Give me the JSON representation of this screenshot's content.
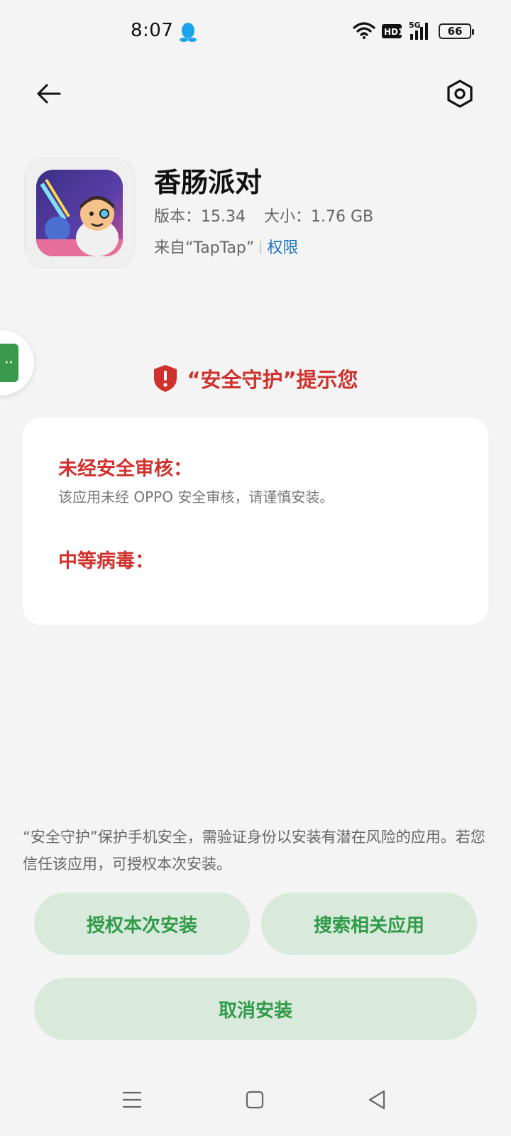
{
  "status_bar": {
    "time": "8:07",
    "hd_label": "HD1",
    "network_label": "5G",
    "battery": "66"
  },
  "app": {
    "name": "香肠派对",
    "version_label": "版本：15.34",
    "size_label": "大小：1.76 GB",
    "source_label": "来自“TapTap”",
    "permission_link": "权限"
  },
  "floating_tab": {
    "label": "··"
  },
  "security": {
    "title": "“安全守护”提示您",
    "unreviewed_heading": "未经安全审核：",
    "unreviewed_text": "该应用未经 OPPO 安全审核，请谨慎安装。",
    "virus_heading": "中等病毒："
  },
  "footer_note": "“安全守护”保护手机安全，需验证身份以安装有潜在风险的应用。若您信任该应用，可授权本次安装。",
  "buttons": {
    "authorize": "授权本次安装",
    "search": "搜索相关应用",
    "cancel": "取消安装"
  },
  "colors": {
    "accent_green": "#2f9b48",
    "button_bg": "#d9eadc",
    "warning_red": "#d0312d",
    "link_blue": "#1a73c8",
    "background": "#f4f4f4"
  },
  "icons": [
    "qq-icon",
    "wifi-icon",
    "hd-icon",
    "signal-icon",
    "battery-icon",
    "back-arrow-icon",
    "settings-icon",
    "app-icon",
    "shield-alert-icon",
    "menu-icon",
    "home-icon",
    "back-icon"
  ]
}
